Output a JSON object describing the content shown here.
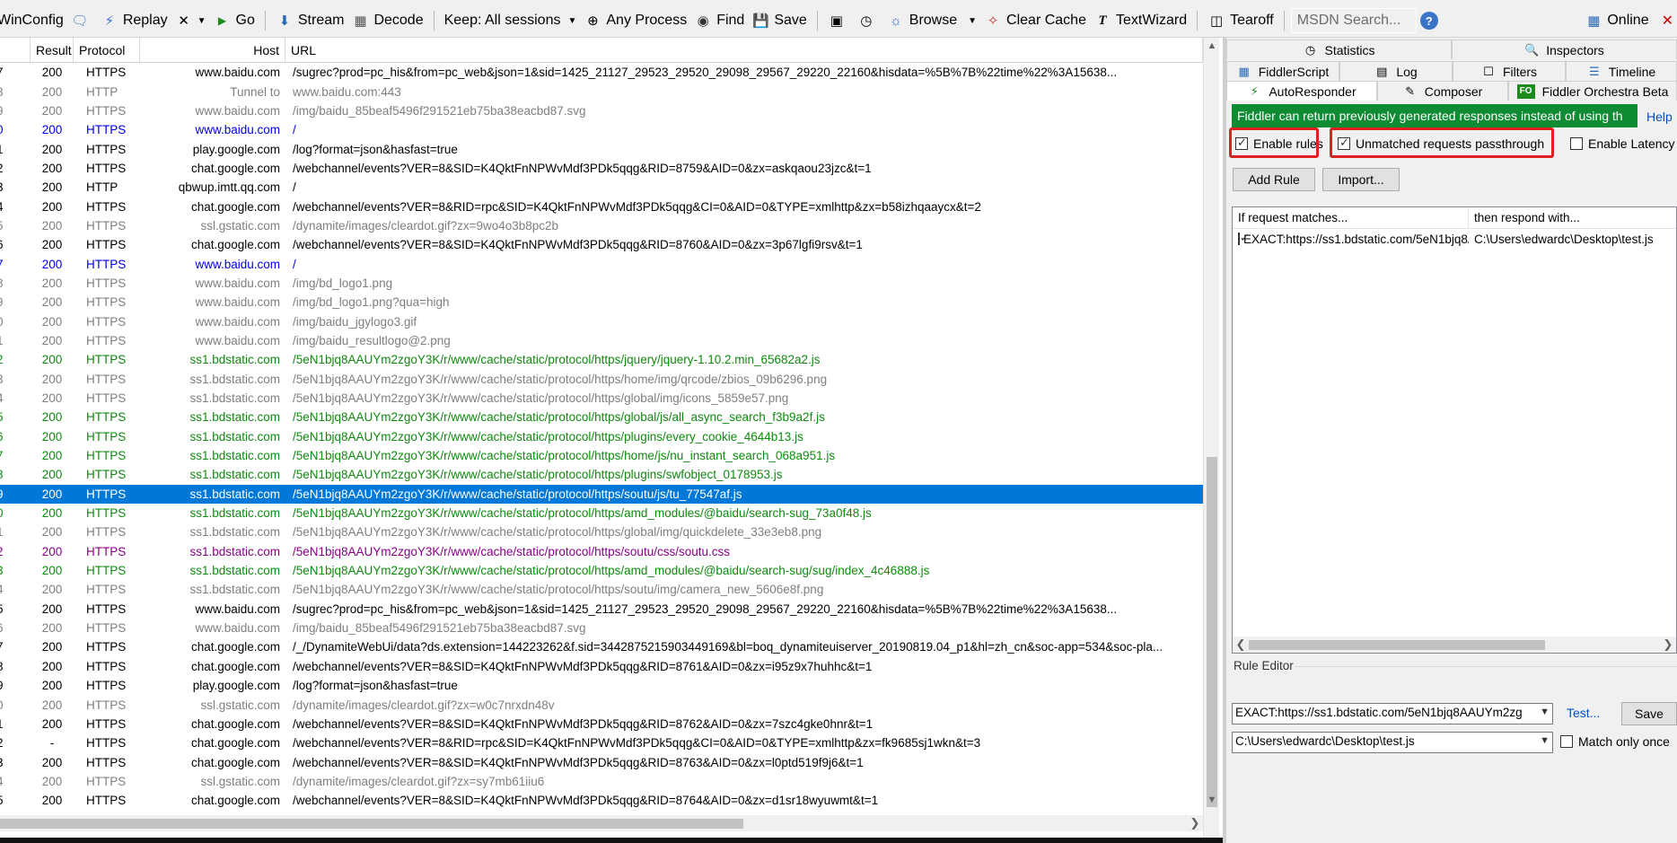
{
  "toolbar": {
    "winconfig": "WinConfig",
    "replay": "Replay",
    "go": "Go",
    "stream": "Stream",
    "decode": "Decode",
    "keep": "Keep: All sessions",
    "any_process": "Any Process",
    "find": "Find",
    "save": "Save",
    "browse": "Browse",
    "clear_cache": "Clear Cache",
    "textwizard": "TextWizard",
    "tearoff": "Tearoff",
    "msdn_search": "MSDN Search...",
    "online": "Online"
  },
  "grid": {
    "headers": {
      "num": "#",
      "result": "Result",
      "protocol": "Protocol",
      "host": "Host",
      "url": "URL"
    },
    "rows": [
      {
        "n": "7",
        "r": "200",
        "p": "HTTPS",
        "h": "www.baidu.com",
        "u": "/sugrec?prod=pc_his&from=pc_web&json=1&sid=1425_21127_29523_29520_29098_29567_29220_22160&hisdata=%5B%7B%22time%22%3A15638...",
        "s": "black"
      },
      {
        "n": "8",
        "r": "200",
        "p": "HTTP",
        "h": "Tunnel to",
        "u": "www.baidu.com:443",
        "s": "gray"
      },
      {
        "n": "9",
        "r": "200",
        "p": "HTTPS",
        "h": "www.baidu.com",
        "u": "/img/baidu_85beaf5496f291521eb75ba38eacbd87.svg",
        "s": "gray"
      },
      {
        "n": "0",
        "r": "200",
        "p": "HTTPS",
        "h": "www.baidu.com",
        "u": "/",
        "s": "blue"
      },
      {
        "n": "1",
        "r": "200",
        "p": "HTTPS",
        "h": "play.google.com",
        "u": "/log?format=json&hasfast=true",
        "s": "black"
      },
      {
        "n": "2",
        "r": "200",
        "p": "HTTPS",
        "h": "chat.google.com",
        "u": "/webchannel/events?VER=8&SID=K4QktFnNPWvMdf3PDk5qqg&RID=8759&AID=0&zx=askqaou23jzc&t=1",
        "s": "black"
      },
      {
        "n": "3",
        "r": "200",
        "p": "HTTP",
        "h": "qbwup.imtt.qq.com",
        "u": "/",
        "s": "black"
      },
      {
        "n": "4",
        "r": "200",
        "p": "HTTPS",
        "h": "chat.google.com",
        "u": "/webchannel/events?VER=8&RID=rpc&SID=K4QktFnNPWvMdf3PDk5qqg&CI=0&AID=0&TYPE=xmlhttp&zx=b58izhqaaycx&t=2",
        "s": "black"
      },
      {
        "n": "5",
        "r": "200",
        "p": "HTTPS",
        "h": "ssl.gstatic.com",
        "u": "/dynamite/images/cleardot.gif?zx=9wo4o3b8pc2b",
        "s": "gray"
      },
      {
        "n": "6",
        "r": "200",
        "p": "HTTPS",
        "h": "chat.google.com",
        "u": "/webchannel/events?VER=8&SID=K4QktFnNPWvMdf3PDk5qqg&RID=8760&AID=0&zx=3p67lgfi9rsv&t=1",
        "s": "black"
      },
      {
        "n": "7",
        "r": "200",
        "p": "HTTPS",
        "h": "www.baidu.com",
        "u": "/",
        "s": "blue"
      },
      {
        "n": "8",
        "r": "200",
        "p": "HTTPS",
        "h": "www.baidu.com",
        "u": "/img/bd_logo1.png",
        "s": "gray"
      },
      {
        "n": "9",
        "r": "200",
        "p": "HTTPS",
        "h": "www.baidu.com",
        "u": "/img/bd_logo1.png?qua=high",
        "s": "gray"
      },
      {
        "n": "0",
        "r": "200",
        "p": "HTTPS",
        "h": "www.baidu.com",
        "u": "/img/baidu_jgylogo3.gif",
        "s": "gray"
      },
      {
        "n": "1",
        "r": "200",
        "p": "HTTPS",
        "h": "www.baidu.com",
        "u": "/img/baidu_resultlogo@2.png",
        "s": "gray"
      },
      {
        "n": "2",
        "r": "200",
        "p": "HTTPS",
        "h": "ss1.bdstatic.com",
        "u": "/5eN1bjq8AAUYm2zgoY3K/r/www/cache/static/protocol/https/jquery/jquery-1.10.2.min_65682a2.js",
        "s": "green"
      },
      {
        "n": "3",
        "r": "200",
        "p": "HTTPS",
        "h": "ss1.bdstatic.com",
        "u": "/5eN1bjq8AAUYm2zgoY3K/r/www/cache/static/protocol/https/home/img/qrcode/zbios_09b6296.png",
        "s": "gray"
      },
      {
        "n": "4",
        "r": "200",
        "p": "HTTPS",
        "h": "ss1.bdstatic.com",
        "u": "/5eN1bjq8AAUYm2zgoY3K/r/www/cache/static/protocol/https/global/img/icons_5859e57.png",
        "s": "gray"
      },
      {
        "n": "5",
        "r": "200",
        "p": "HTTPS",
        "h": "ss1.bdstatic.com",
        "u": "/5eN1bjq8AAUYm2zgoY3K/r/www/cache/static/protocol/https/global/js/all_async_search_f3b9a2f.js",
        "s": "green"
      },
      {
        "n": "6",
        "r": "200",
        "p": "HTTPS",
        "h": "ss1.bdstatic.com",
        "u": "/5eN1bjq8AAUYm2zgoY3K/r/www/cache/static/protocol/https/plugins/every_cookie_4644b13.js",
        "s": "green"
      },
      {
        "n": "7",
        "r": "200",
        "p": "HTTPS",
        "h": "ss1.bdstatic.com",
        "u": "/5eN1bjq8AAUYm2zgoY3K/r/www/cache/static/protocol/https/home/js/nu_instant_search_068a951.js",
        "s": "green"
      },
      {
        "n": "8",
        "r": "200",
        "p": "HTTPS",
        "h": "ss1.bdstatic.com",
        "u": "/5eN1bjq8AAUYm2zgoY3K/r/www/cache/static/protocol/https/plugins/swfobject_0178953.js",
        "s": "green"
      },
      {
        "n": "9",
        "r": "200",
        "p": "HTTPS",
        "h": "ss1.bdstatic.com",
        "u": "/5eN1bjq8AAUYm2zgoY3K/r/www/cache/static/protocol/https/soutu/js/tu_77547af.js",
        "s": "selected"
      },
      {
        "n": "0",
        "r": "200",
        "p": "HTTPS",
        "h": "ss1.bdstatic.com",
        "u": "/5eN1bjq8AAUYm2zgoY3K/r/www/cache/static/protocol/https/amd_modules/@baidu/search-sug_73a0f48.js",
        "s": "green"
      },
      {
        "n": "1",
        "r": "200",
        "p": "HTTPS",
        "h": "ss1.bdstatic.com",
        "u": "/5eN1bjq8AAUYm2zgoY3K/r/www/cache/static/protocol/https/global/img/quickdelete_33e3eb8.png",
        "s": "gray"
      },
      {
        "n": "2",
        "r": "200",
        "p": "HTTPS",
        "h": "ss1.bdstatic.com",
        "u": "/5eN1bjq8AAUYm2zgoY3K/r/www/cache/static/protocol/https/soutu/css/soutu.css",
        "s": "purple"
      },
      {
        "n": "3",
        "r": "200",
        "p": "HTTPS",
        "h": "ss1.bdstatic.com",
        "u": "/5eN1bjq8AAUYm2zgoY3K/r/www/cache/static/protocol/https/amd_modules/@baidu/search-sug/sug/index_4c46888.js",
        "s": "green"
      },
      {
        "n": "4",
        "r": "200",
        "p": "HTTPS",
        "h": "ss1.bdstatic.com",
        "u": "/5eN1bjq8AAUYm2zgoY3K/r/www/cache/static/protocol/https/soutu/img/camera_new_5606e8f.png",
        "s": "gray"
      },
      {
        "n": "5",
        "r": "200",
        "p": "HTTPS",
        "h": "www.baidu.com",
        "u": "/sugrec?prod=pc_his&from=pc_web&json=1&sid=1425_21127_29523_29520_29098_29567_29220_22160&hisdata=%5B%7B%22time%22%3A15638...",
        "s": "black"
      },
      {
        "n": "6",
        "r": "200",
        "p": "HTTPS",
        "h": "www.baidu.com",
        "u": "/img/baidu_85beaf5496f291521eb75ba38eacbd87.svg",
        "s": "gray"
      },
      {
        "n": "7",
        "r": "200",
        "p": "HTTPS",
        "h": "chat.google.com",
        "u": "/_/DynamiteWebUi/data?ds.extension=144223262&f.sid=3442875215903449169&bl=boq_dynamiteuiserver_20190819.04_p1&hl=zh_cn&soc-app=534&soc-pla...",
        "s": "black"
      },
      {
        "n": "8",
        "r": "200",
        "p": "HTTPS",
        "h": "chat.google.com",
        "u": "/webchannel/events?VER=8&SID=K4QktFnNPWvMdf3PDk5qqg&RID=8761&AID=0&zx=i95z9x7huhhc&t=1",
        "s": "black"
      },
      {
        "n": "9",
        "r": "200",
        "p": "HTTPS",
        "h": "play.google.com",
        "u": "/log?format=json&hasfast=true",
        "s": "black"
      },
      {
        "n": "0",
        "r": "200",
        "p": "HTTPS",
        "h": "ssl.gstatic.com",
        "u": "/dynamite/images/cleardot.gif?zx=w0c7nrxdn48v",
        "s": "gray"
      },
      {
        "n": "1",
        "r": "200",
        "p": "HTTPS",
        "h": "chat.google.com",
        "u": "/webchannel/events?VER=8&SID=K4QktFnNPWvMdf3PDk5qqg&RID=8762&AID=0&zx=7szc4gke0hnr&t=1",
        "s": "black"
      },
      {
        "n": "2",
        "r": "-",
        "p": "HTTPS",
        "h": "chat.google.com",
        "u": "/webchannel/events?VER=8&RID=rpc&SID=K4QktFnNPWvMdf3PDk5qqg&CI=0&AID=0&TYPE=xmlhttp&zx=fk9685sj1wkn&t=3",
        "s": "black"
      },
      {
        "n": "3",
        "r": "200",
        "p": "HTTPS",
        "h": "chat.google.com",
        "u": "/webchannel/events?VER=8&SID=K4QktFnNPWvMdf3PDk5qqg&RID=8763&AID=0&zx=l0ptd519f9j6&t=1",
        "s": "black"
      },
      {
        "n": "4",
        "r": "200",
        "p": "HTTPS",
        "h": "ssl.gstatic.com",
        "u": "/dynamite/images/cleardot.gif?zx=sy7mb61iiu6",
        "s": "gray"
      },
      {
        "n": "5",
        "r": "200",
        "p": "HTTPS",
        "h": "chat.google.com",
        "u": "/webchannel/events?VER=8&SID=K4QktFnNPWvMdf3PDk5qqg&RID=8764&AID=0&zx=d1sr18wyuwmt&t=1",
        "s": "black"
      }
    ]
  },
  "right": {
    "tabs_row1": {
      "statistics": "Statistics",
      "inspectors": "Inspectors"
    },
    "tabs_row2": {
      "fiddlerscript": "FiddlerScript",
      "log": "Log",
      "filters": "Filters",
      "timeline": "Timeline"
    },
    "tabs_row3": {
      "autoresponder": "AutoResponder",
      "composer": "Composer",
      "orchestra": "Fiddler Orchestra Beta",
      "orchestra_badge": "FO"
    },
    "banner": "Fiddler can return previously generated responses instead of using th",
    "help": "Help",
    "enable_rules": "Enable rules",
    "unmatched_passthrough": "Unmatched requests passthrough",
    "enable_latency": "Enable Latency",
    "add_rule": "Add Rule",
    "import": "Import...",
    "rules_header": {
      "match": "If request matches...",
      "respond": "then respond with..."
    },
    "rules": [
      {
        "match": "EXACT:https://ss1.bdstatic.com/5eN1bjq8A...",
        "respond": "C:\\Users\\edwardc\\Desktop\\test.js"
      }
    ],
    "rule_editor": {
      "label": "Rule Editor",
      "match_value": "EXACT:https://ss1.bdstatic.com/5eN1bjq8AAUYm2zg",
      "test": "Test...",
      "save": "Save",
      "respond_value": "C:\\Users\\edwardc\\Desktop\\test.js",
      "match_only_once": "Match only once"
    }
  },
  "colors": {
    "selected_row": "#0078d7",
    "banner_green": "#0f8b33",
    "highlight_red": "#e02020",
    "text_green": "#0f8b0f",
    "text_blue": "#0000ee",
    "text_purple": "#8b008b"
  }
}
